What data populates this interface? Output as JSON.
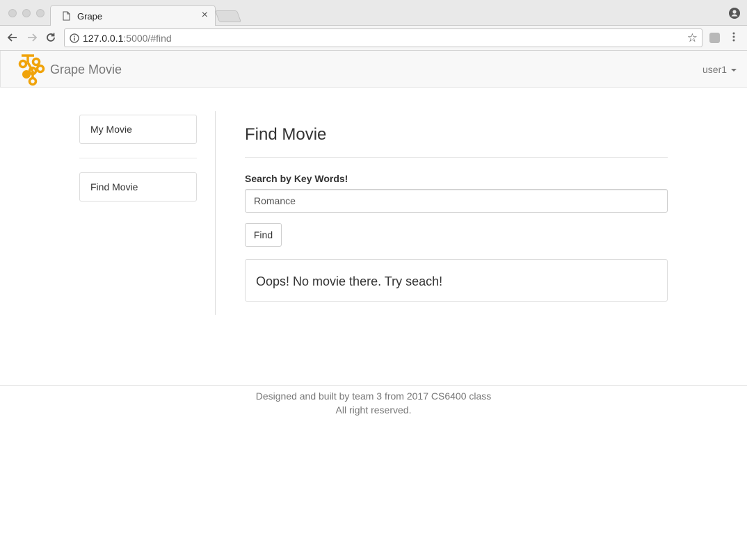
{
  "browser": {
    "tab_title": "Grape",
    "tab_close": "×",
    "url_host": "127.0.0.1",
    "url_rest": ":5000/#find",
    "star": "☆",
    "menu": "⋮",
    "icons": {
      "back": "arrow-left-icon",
      "forward": "arrow-right-icon",
      "reload": "reload-icon",
      "info": "info-icon",
      "profile": "profile-icon",
      "extension": "extension-icon"
    }
  },
  "navbar": {
    "brand": "Grape Movie",
    "user": "user1",
    "brand_color": "#f0a30a"
  },
  "sidebar": {
    "items": [
      {
        "label": "My Movie"
      },
      {
        "label": "Find Movie"
      }
    ]
  },
  "main": {
    "title": "Find Movie",
    "search_label": "Search by Key Words!",
    "search_value": "Romance",
    "find_label": "Find",
    "result_message": "Oops! No movie there. Try seach!"
  },
  "footer": {
    "line1": "Designed and built by team 3 from 2017 CS6400 class",
    "line2": "All right reserved."
  }
}
